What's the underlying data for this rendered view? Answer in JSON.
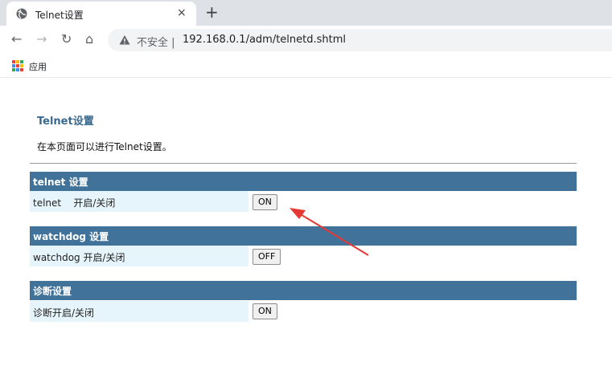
{
  "browser": {
    "tab_title": "Telnet设置",
    "tab_close": "×",
    "new_tab": "+",
    "nav": {
      "back": "←",
      "forward": "→",
      "reload": "↻",
      "home": "⌂"
    },
    "security_label": "不安全",
    "separator": "|",
    "url": "192.168.0.1/adm/telnetd.shtml",
    "bookmarks": {
      "apps_label": "应用"
    }
  },
  "page": {
    "title": "Telnet设置",
    "description": "在本页面可以进行Telnet设置。",
    "sections": [
      {
        "header": "telnet 设置",
        "label": "telnet    开启/关闭",
        "button": "ON"
      },
      {
        "header": "watchdog 设置",
        "label": "watchdog 开启/关闭",
        "button": "OFF"
      },
      {
        "header": "诊断设置",
        "label": "诊断开启/关闭",
        "button": "ON"
      }
    ]
  },
  "colors": {
    "section_header": "#41729a",
    "label_bg": "#e6f4fb",
    "title": "#3b6a8f",
    "annotation_arrow": "#e53935"
  }
}
